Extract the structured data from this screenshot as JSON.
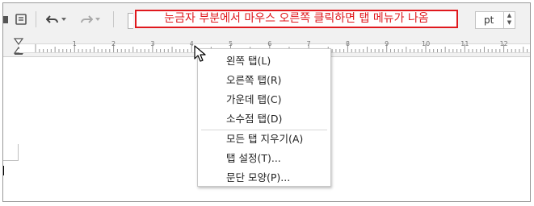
{
  "toolbar": {
    "callout_text": "눈금자 부분에서 마우스 오른쪽 클릭하면 탭 메뉴가 나옴",
    "font_size_unit": "pt",
    "icons": [
      "partial-icon",
      "document-icon",
      "undo-icon",
      "dropdown-arrow-icon",
      "redo-icon",
      "dropdown-arrow-icon",
      "spin-up-icon",
      "spin-down-icon"
    ]
  },
  "ruler": {
    "numbers": [
      "1",
      "2",
      "3",
      "4",
      "5",
      "6",
      "7",
      "8",
      "9",
      "10",
      "11",
      "12",
      "13"
    ]
  },
  "context_menu": {
    "items": [
      {
        "label": "왼쪽 탭(L)"
      },
      {
        "label": "오른쪽 탭(R)"
      },
      {
        "label": "가운데 탭(C)"
      },
      {
        "label": "소수점 탭(D)"
      },
      {
        "label": "모든 탭 지우기(A)"
      },
      {
        "label": "탭 설정(T)..."
      },
      {
        "label": "문단 모양(P)..."
      }
    ]
  }
}
